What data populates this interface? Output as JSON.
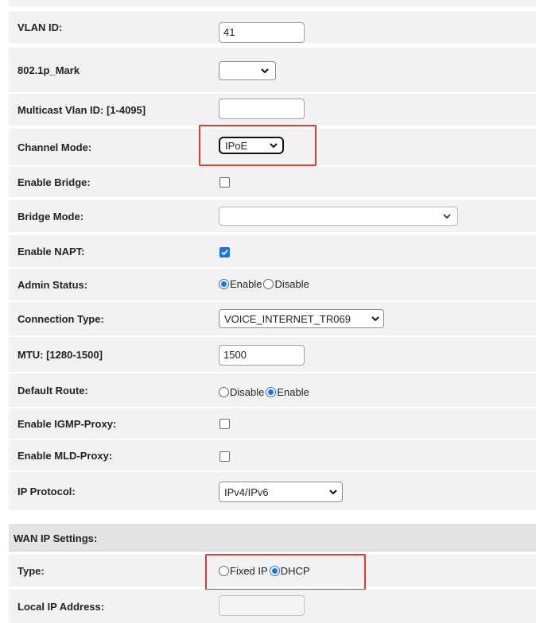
{
  "fields": {
    "vlan_id": {
      "label": "VLAN ID:",
      "value": "41"
    },
    "p8021_mark": {
      "label": "802.1p_Mark",
      "value": ""
    },
    "multicast_vlan": {
      "label": "Multicast Vlan ID: [1-4095]",
      "value": ""
    },
    "channel_mode": {
      "label": "Channel Mode:",
      "value": "IPoE"
    },
    "enable_bridge": {
      "label": "Enable Bridge:",
      "checked": false
    },
    "bridge_mode": {
      "label": "Bridge Mode:",
      "value": ""
    },
    "enable_napt": {
      "label": "Enable NAPT:",
      "checked": true
    },
    "admin_status": {
      "label": "Admin Status:",
      "options": [
        "Enable",
        "Disable"
      ],
      "selected": "Enable"
    },
    "connection_type": {
      "label": "Connection Type:",
      "value": "VOICE_INTERNET_TR069"
    },
    "mtu": {
      "label": "MTU: [1280-1500]",
      "value": "1500"
    },
    "default_route": {
      "label": "Default Route:",
      "options": [
        "Disable",
        "Enable"
      ],
      "selected": "Enable"
    },
    "enable_igmp": {
      "label": "Enable IGMP-Proxy:",
      "checked": false
    },
    "enable_mld": {
      "label": "Enable MLD-Proxy:",
      "checked": false
    },
    "ip_protocol": {
      "label": "IP Protocol:",
      "value": "IPv4/IPv6"
    }
  },
  "wan_ip": {
    "title": "WAN IP Settings:",
    "type": {
      "label": "Type:",
      "options": [
        "Fixed IP",
        "DHCP"
      ],
      "selected": "DHCP"
    },
    "local_ip": {
      "label": "Local IP Address:",
      "value": ""
    }
  },
  "colors": {
    "highlight": "#e53935",
    "accent": "#1a73e8"
  }
}
